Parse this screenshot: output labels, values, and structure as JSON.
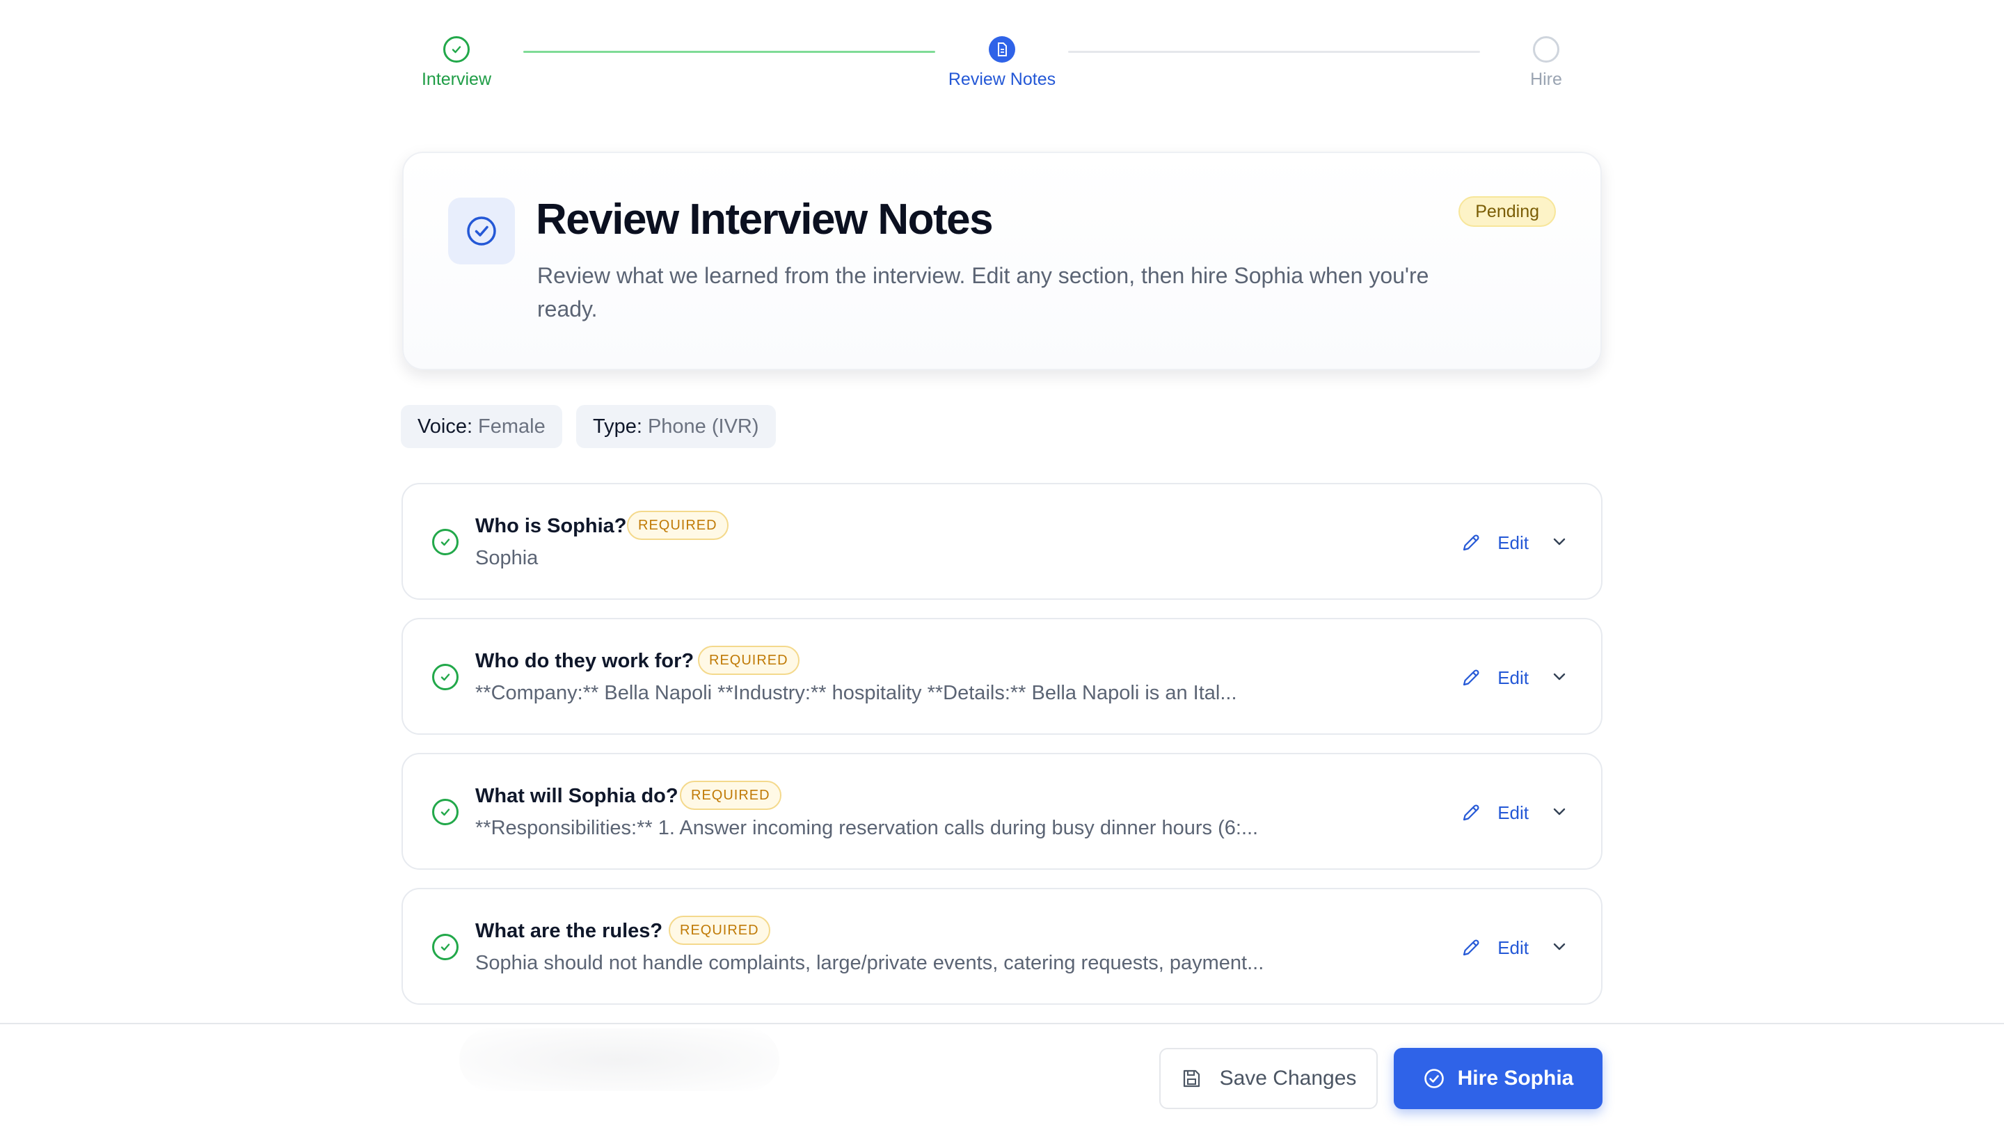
{
  "stepper": {
    "steps": [
      {
        "label": "Interview",
        "state": "done",
        "icon": "check-icon"
      },
      {
        "label": "Review Notes",
        "state": "active",
        "icon": "document-icon"
      },
      {
        "label": "Hire",
        "state": "todo",
        "icon": "empty-circle-icon"
      }
    ]
  },
  "header": {
    "icon": "check-circle-icon",
    "title": "Review Interview Notes",
    "description": "Review what we learned from the interview. Edit any section, then hire Sophia when you're ready.",
    "status": "Pending"
  },
  "meta": {
    "voice": {
      "key": "Voice:",
      "value": "Female"
    },
    "type": {
      "key": "Type:",
      "value": "Phone (IVR)"
    }
  },
  "sections": [
    {
      "title": "Who is Sophia?",
      "badge": "REQUIRED",
      "summary": "Sophia",
      "edit_label": "Edit"
    },
    {
      "title": "Who do they work for?",
      "badge": "REQUIRED",
      "summary": "**Company:** Bella Napoli **Industry:** hospitality **Details:** Bella Napoli is an Ital...",
      "edit_label": "Edit"
    },
    {
      "title": "What will Sophia do?",
      "badge": "REQUIRED",
      "summary": "**Responsibilities:** 1. Answer incoming reservation calls during busy dinner hours (6:...",
      "edit_label": "Edit"
    },
    {
      "title": "What are the rules?",
      "badge": "REQUIRED",
      "summary": "Sophia should not handle complaints, large/private events, catering requests, payment...",
      "edit_label": "Edit"
    }
  ],
  "footer": {
    "save_label": "Save Changes",
    "hire_label": "Hire Sophia"
  },
  "colors": {
    "accent": "#2f63e8",
    "success": "#22a84a",
    "pending_bg": "#fdf3c7",
    "required": "#c07a06"
  }
}
